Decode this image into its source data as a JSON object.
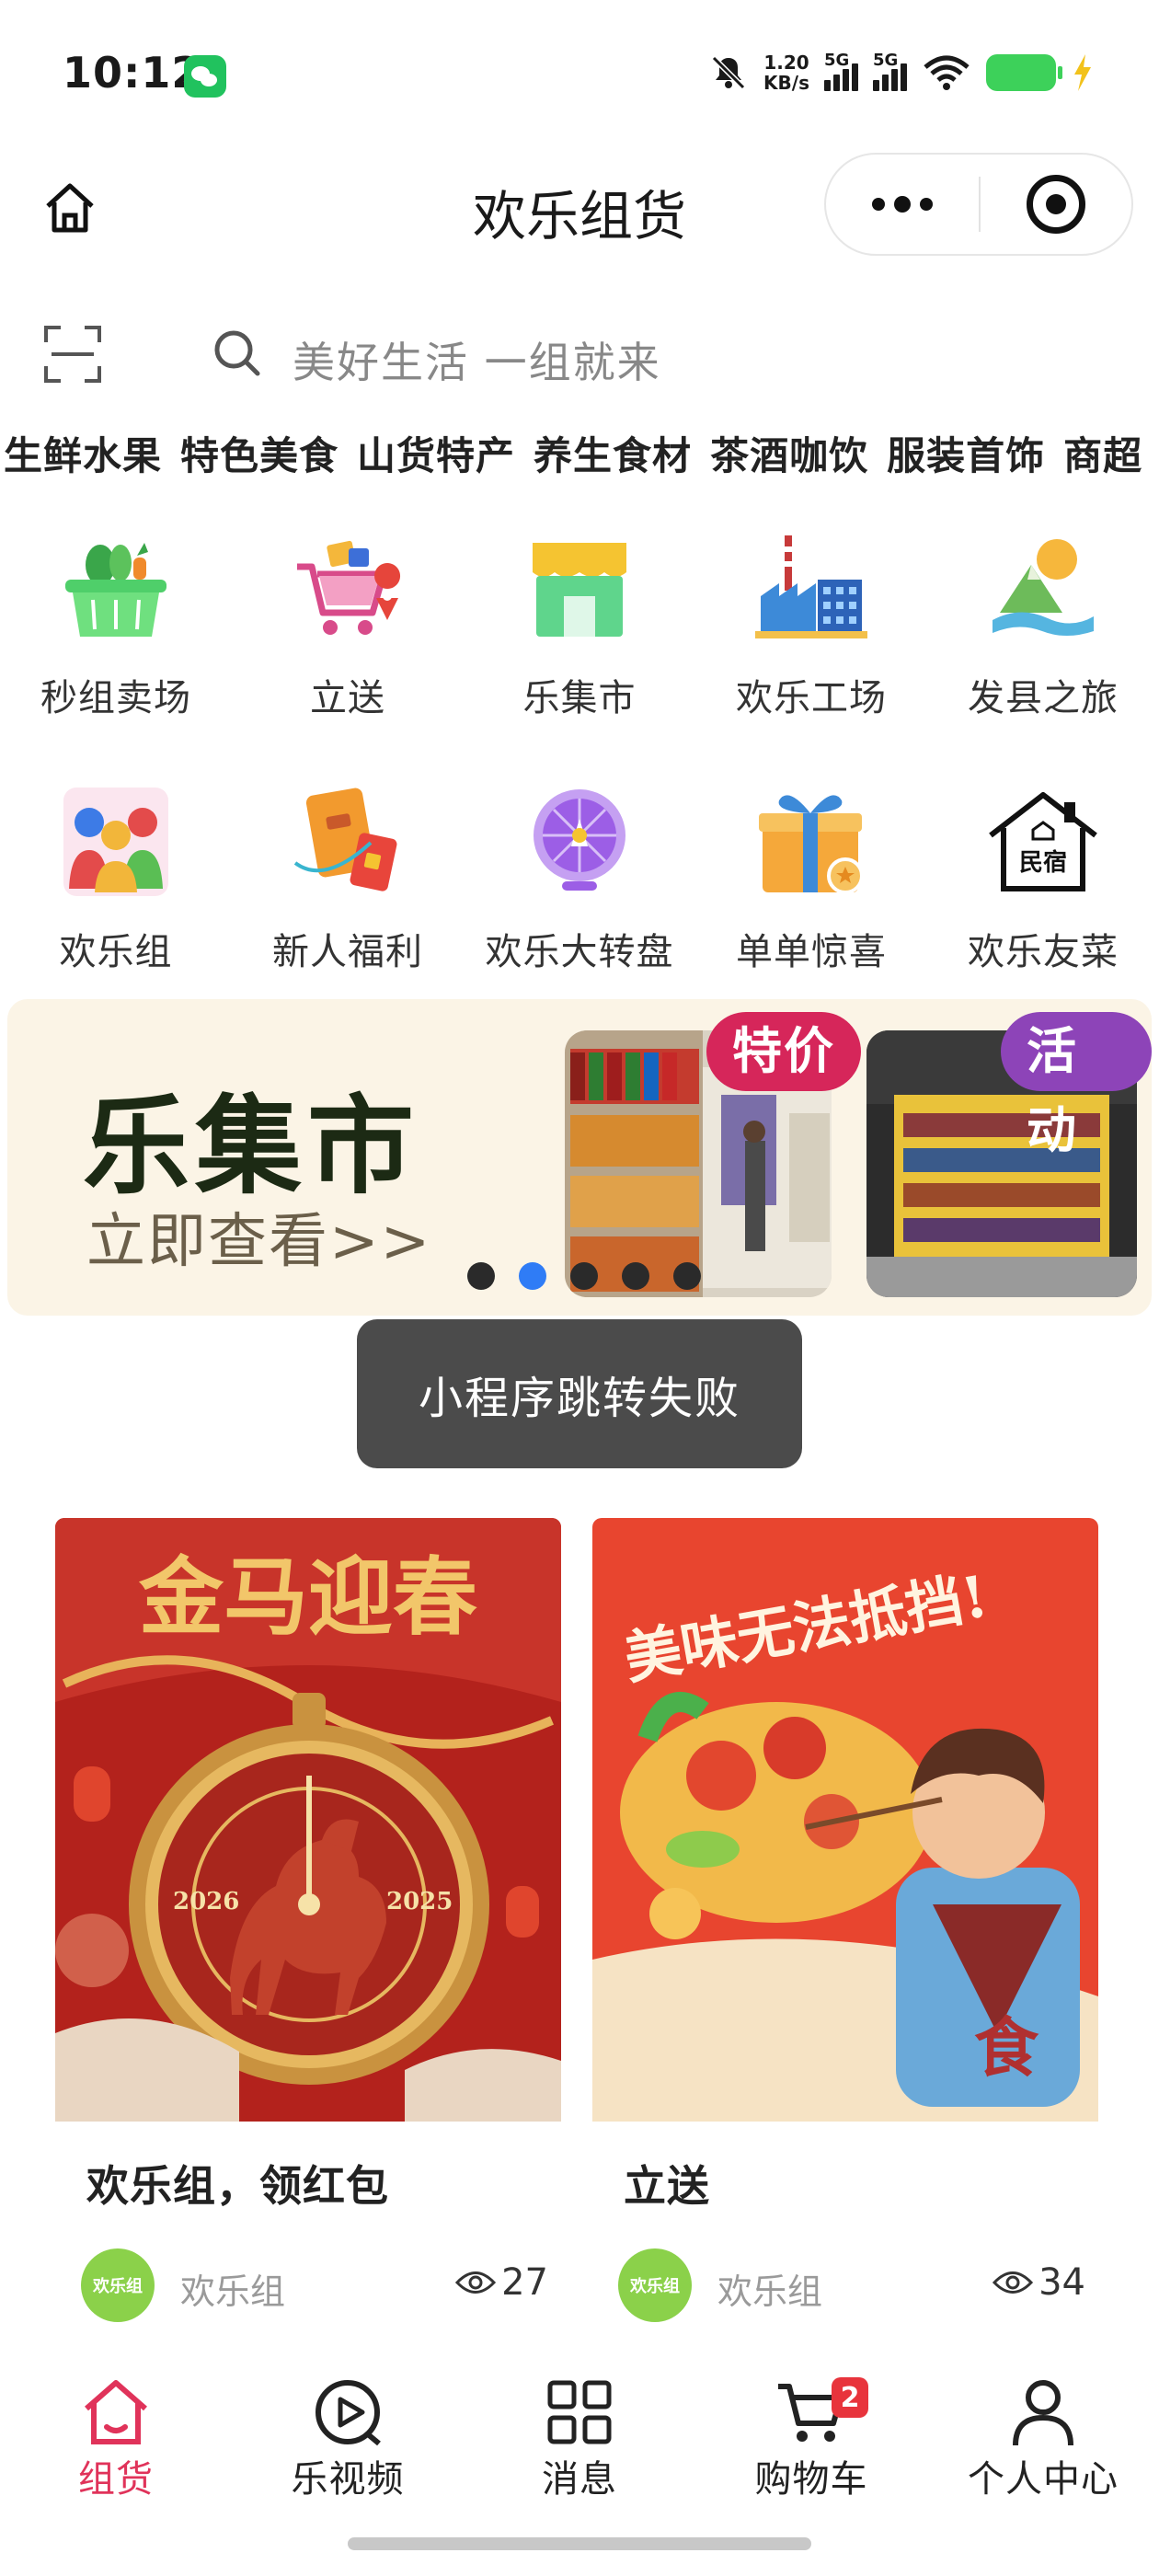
{
  "status_bar": {
    "time": "10:12",
    "net_speed_value": "1.20",
    "net_speed_unit": "KB/s",
    "signal_1_label": "5G",
    "signal_2_label": "5G",
    "battery_color": "#3dd15a"
  },
  "nav": {
    "title": "欢乐组货"
  },
  "search": {
    "placeholder": "美好生活 一组就来"
  },
  "categories": [
    "生鲜水果",
    "特色美食",
    "山货特产",
    "养生食材",
    "茶酒咖饮",
    "服装首饰",
    "商超"
  ],
  "quick_entries": [
    {
      "label": "秒组卖场",
      "icon": "shopping-basket-icon"
    },
    {
      "label": "立送",
      "icon": "delivery-cart-icon"
    },
    {
      "label": "乐集市",
      "icon": "market-stall-icon"
    },
    {
      "label": "欢乐工场",
      "icon": "factory-icon"
    },
    {
      "label": "发县之旅",
      "icon": "mountain-travel-icon"
    },
    {
      "label": "欢乐组",
      "icon": "group-people-icon"
    },
    {
      "label": "新人福利",
      "icon": "red-envelope-icon"
    },
    {
      "label": "欢乐大转盘",
      "icon": "prize-wheel-icon"
    },
    {
      "label": "单单惊喜",
      "icon": "gift-box-icon"
    },
    {
      "label": "欢乐友菜",
      "icon": "homestay-icon"
    }
  ],
  "quick_entries_extra": {
    "homestay_sign": "民宿"
  },
  "banner": {
    "title": "乐集市",
    "subtitle": "立即查看>>",
    "tag_1": "特价",
    "tag_2": "活动",
    "slide_count": 5,
    "active_slide": 2
  },
  "toast": {
    "message": "小程序跳转失败"
  },
  "feed": [
    {
      "title": "欢乐组，领红包",
      "author": "欢乐组",
      "views": "27",
      "image_text": "金马迎春",
      "year_left": "2026",
      "year_right": "2025",
      "avatar_text": "欢乐组"
    },
    {
      "title": "立送",
      "author": "欢乐组",
      "views": "34",
      "image_text": "美味无法抵挡!",
      "apron_text": "食",
      "avatar_text": "欢乐组"
    }
  ],
  "tabbar": [
    {
      "label": "组货",
      "icon": "home-icon",
      "active": true
    },
    {
      "label": "乐视频",
      "icon": "video-play-icon",
      "active": false
    },
    {
      "label": "消息",
      "icon": "grid-icon",
      "active": false
    },
    {
      "label": "购物车",
      "icon": "cart-icon",
      "active": false,
      "badge": "2"
    },
    {
      "label": "个人中心",
      "icon": "user-icon",
      "active": false
    }
  ],
  "colors": {
    "accent": "#e0335a",
    "toast_bg": "#4b4b4b",
    "tag_special": "#d6265a",
    "tag_event": "#8d44b8",
    "dot_active": "#2f7cf6"
  }
}
